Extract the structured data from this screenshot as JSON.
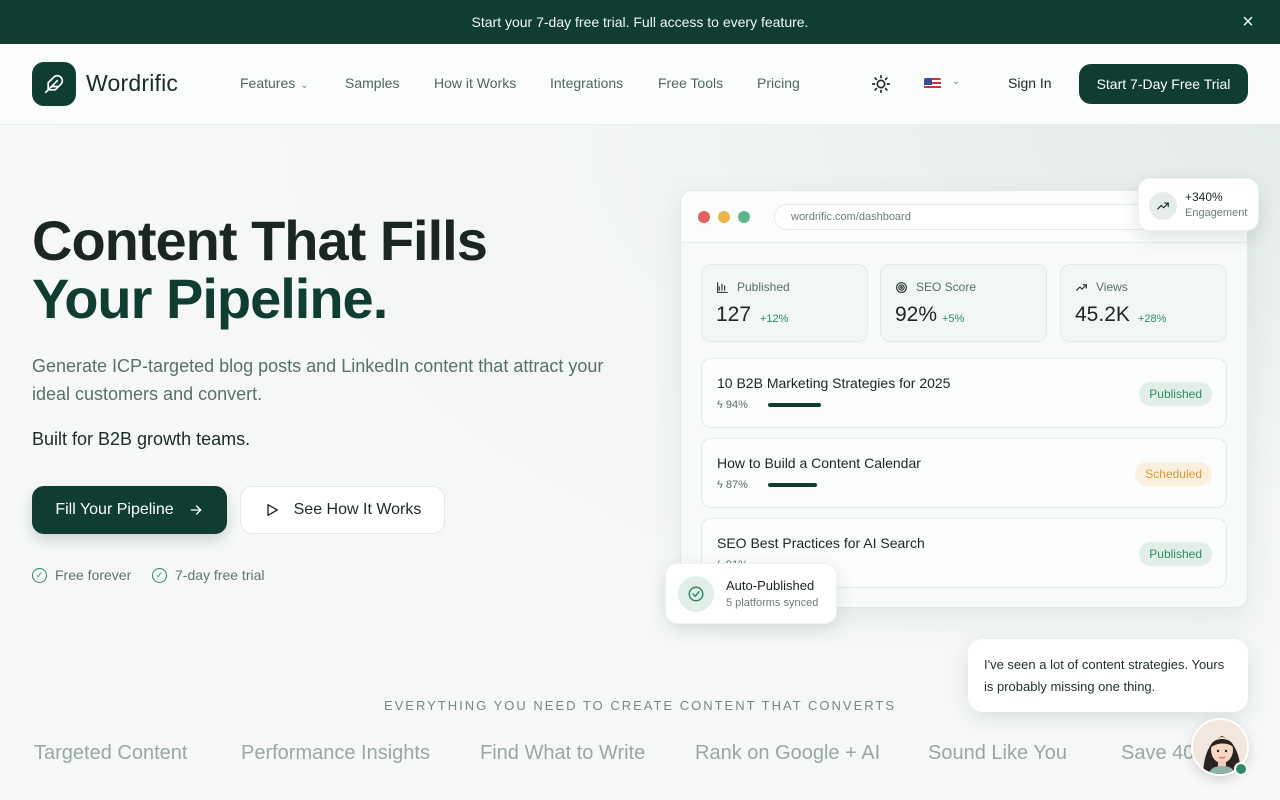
{
  "banner": {
    "text": "Start your 7-day free trial. Full access to every feature.",
    "close_icon": "close-icon"
  },
  "nav": {
    "brand": "Wordrific",
    "links": [
      {
        "label": "Features",
        "has_dropdown": true
      },
      {
        "label": "Samples"
      },
      {
        "label": "How it Works"
      },
      {
        "label": "Integrations"
      },
      {
        "label": "Free Tools"
      },
      {
        "label": "Pricing"
      }
    ],
    "sign_in": "Sign In",
    "cta": "Start 7-Day Free Trial"
  },
  "hero": {
    "title_line1": "Content That Fills",
    "title_line2": "Your Pipeline.",
    "subtitle": "Generate ICP-targeted blog posts and LinkedIn content that attract your ideal customers and convert.",
    "built_for": "Built for B2B growth teams.",
    "primary_button": "Fill Your Pipeline",
    "secondary_button": "See How It Works",
    "perks": [
      "Free forever",
      "7-day free trial"
    ]
  },
  "dashboard": {
    "url": "wordrific.com/dashboard",
    "stats": [
      {
        "label": "Published",
        "value": "127",
        "delta": "+12%"
      },
      {
        "label": "SEO Score",
        "value": "92%",
        "delta": "+5%"
      },
      {
        "label": "Views",
        "value": "45.2K",
        "delta": "+28%"
      }
    ],
    "posts": [
      {
        "title": "10 B2B Marketing Strategies for 2025",
        "score": "94%",
        "score_value": 94,
        "status": "Published"
      },
      {
        "title": "How to Build a Content Calendar",
        "score": "87%",
        "score_value": 87,
        "status": "Scheduled"
      },
      {
        "title": "SEO Best Practices for AI Search",
        "score": "91%",
        "score_value": 91,
        "status": "Published"
      }
    ]
  },
  "floats": {
    "engagement_value": "+340%",
    "engagement_label": "Engagement",
    "auto_title": "Auto-Published",
    "auto_sub": "5 platforms synced"
  },
  "features": {
    "section_label": "EVERYTHING YOU NEED TO CREATE CONTENT THAT CONVERTS",
    "items": [
      "Targeted Content",
      "Performance Insights",
      "Find What to Write",
      "Rank on Google + AI",
      "Sound Like You",
      "Save 40"
    ]
  },
  "chat": {
    "message": "I've seen a lot of content strategies. Yours is probably missing one thing."
  },
  "colors": {
    "brand": "#0f3d32",
    "accent": "#2f8a67",
    "scheduled": "#d99a3a"
  }
}
